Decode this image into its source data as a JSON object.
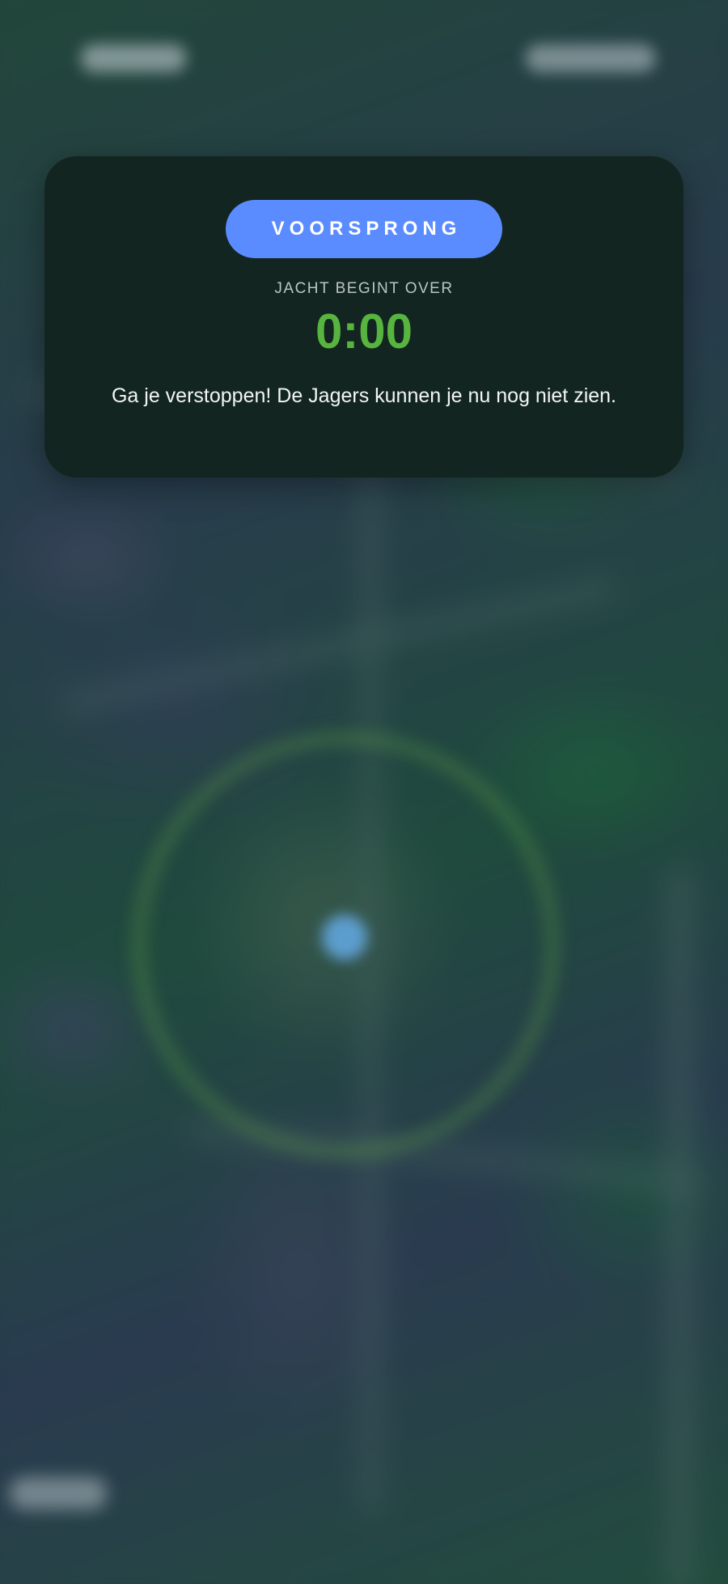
{
  "card": {
    "phase_label": "VOORSPRONG",
    "countdown_label": "JACHT BEGINT OVER",
    "countdown_value": "0:00",
    "message": "Ga je verstoppen! De Jagers kunnen je nu nog niet zien."
  },
  "colors": {
    "card_background": "#132520",
    "phase_pill": "#5b8cff",
    "timer": "#57b43f",
    "location_dot": "#64aae6"
  },
  "icons": {
    "location": "location-dot-icon"
  }
}
